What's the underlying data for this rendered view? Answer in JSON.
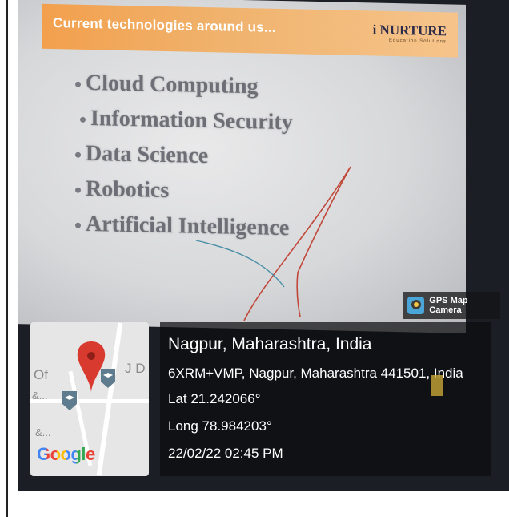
{
  "slide": {
    "title": "Current technologies around us...",
    "brand_name": "i NURTURE",
    "brand_sub": "Education Solutions",
    "bullets": [
      "Cloud Computing",
      "Information Security",
      "Data Science",
      "Robotics",
      "Artificial Intelligence"
    ],
    "header_color": "#f2a04d"
  },
  "gps_badge": {
    "label": "GPS Map Camera",
    "icon": "gps-map-camera-icon"
  },
  "map": {
    "labels": [
      "Of",
      "&...",
      "J D",
      "&..."
    ],
    "pin_icon": "map-pin-icon",
    "school_icon": "graduation-cap-icon",
    "logo_text": "Google"
  },
  "location": {
    "city": "Nagpur, Maharashtra, India",
    "address": "6XRM+VMP, Nagpur, Maharashtra 441501, India",
    "lat": "Lat 21.242066°",
    "long": "Long 78.984203°",
    "datetime": "22/02/22 02:45 PM"
  }
}
